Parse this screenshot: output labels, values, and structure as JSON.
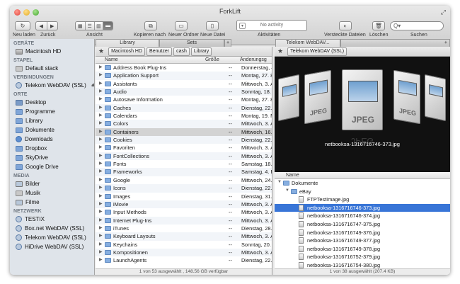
{
  "window": {
    "title": "ForkLift"
  },
  "toolbar": {
    "back_label": "Neu laden",
    "forward_label": "Zurück",
    "view_label": "Ansicht",
    "copy_label": "Kopieren nach",
    "new_folder_label": "Neuer Ordner",
    "new_file_label": "Neue Datei",
    "activity_label": "Aktivitäten",
    "activity_text": "No activity",
    "hidden_files_label": "Versteckte Dateien",
    "delete_label": "Löschen",
    "search_label": "Suchen",
    "search_placeholder": "Q▾"
  },
  "sidebar": {
    "sections": [
      {
        "title": "GERÄTE",
        "items": [
          {
            "label": "Macintosh HD",
            "icon": "hard-drive-icon"
          }
        ]
      },
      {
        "title": "Stapel",
        "items": [
          {
            "label": "Default stack",
            "icon": "stack-icon"
          }
        ]
      },
      {
        "title": "VERBINDUNGEN",
        "items": [
          {
            "label": "Telekom WebDAV (SSL)",
            "icon": "network-icon",
            "eject": "⏏"
          }
        ]
      },
      {
        "title": "ORTE",
        "items": [
          {
            "label": "Desktop",
            "icon": "desktop-icon"
          },
          {
            "label": "Programme",
            "icon": "applications-icon"
          },
          {
            "label": "Library",
            "icon": "folder-icon"
          },
          {
            "label": "Dokumente",
            "icon": "documents-icon"
          },
          {
            "label": "Downloads",
            "icon": "downloads-icon"
          },
          {
            "label": "Dropbox",
            "icon": "folder-icon"
          },
          {
            "label": "SkyDrive",
            "icon": "folder-icon"
          },
          {
            "label": "Google Drive",
            "icon": "folder-icon"
          }
        ]
      },
      {
        "title": "MEDIA",
        "items": [
          {
            "label": "Bilder",
            "icon": "pictures-icon"
          },
          {
            "label": "Musik",
            "icon": "music-icon"
          },
          {
            "label": "Filme",
            "icon": "movies-icon"
          }
        ]
      },
      {
        "title": "NETZWERK",
        "items": [
          {
            "label": "TESTIX",
            "icon": "network-icon"
          },
          {
            "label": "Box.net WebDAV (SSL)",
            "icon": "network-icon"
          },
          {
            "label": "Telekom WebDAV (SSL)",
            "icon": "network-icon"
          },
          {
            "label": "HiDrive WebDAV (SSL)",
            "icon": "network-icon"
          }
        ]
      }
    ]
  },
  "left_tabs": [
    "Library",
    "Sets",
    "+"
  ],
  "right_tabs": [
    "Telekom WebDAV...",
    "+"
  ],
  "left_pane": {
    "breadcrumbs": [
      "Macintosh HD",
      "Benutzer",
      "cash",
      "Library"
    ],
    "columns": [
      "Name",
      "Größe",
      "Änderungsg"
    ],
    "rows": [
      {
        "name": "Address Book Plug-Ins",
        "size": "--",
        "date": "Donnerstag, 4"
      },
      {
        "name": "Application Support",
        "size": "--",
        "date": "Montag, 27. 8"
      },
      {
        "name": "Assistants",
        "size": "--",
        "date": "Mittwoch, 3. A"
      },
      {
        "name": "Audio",
        "size": "--",
        "date": "Sonntag, 18. I"
      },
      {
        "name": "Autosave Information",
        "size": "--",
        "date": "Montag, 27. 8"
      },
      {
        "name": "Caches",
        "size": "--",
        "date": "Dienstag, 22."
      },
      {
        "name": "Calendars",
        "size": "--",
        "date": "Montag, 19. M"
      },
      {
        "name": "Colors",
        "size": "--",
        "date": "Mittwoch, 3. A"
      },
      {
        "name": "Containers",
        "size": "--",
        "date": "Mittwoch, 16."
      },
      {
        "name": "Cookies",
        "size": "--",
        "date": "Dienstag, 22."
      },
      {
        "name": "Favoriten",
        "size": "--",
        "date": "Mittwoch, 3. A"
      },
      {
        "name": "FontCollections",
        "size": "--",
        "date": "Mittwoch, 3. A"
      },
      {
        "name": "Fonts",
        "size": "--",
        "date": "Samstag, 18."
      },
      {
        "name": "Frameworks",
        "size": "--",
        "date": "Samstag, 4. F"
      },
      {
        "name": "Google",
        "size": "--",
        "date": "Mittwoch, 24."
      },
      {
        "name": "Icons",
        "size": "--",
        "date": "Dienstag, 22."
      },
      {
        "name": "Images",
        "size": "--",
        "date": "Dienstag, 31."
      },
      {
        "name": "iMovie",
        "size": "--",
        "date": "Mittwoch, 3. A"
      },
      {
        "name": "Input Methods",
        "size": "--",
        "date": "Mittwoch, 3. A"
      },
      {
        "name": "Internet Plug-Ins",
        "size": "--",
        "date": "Mittwoch, 3. A"
      },
      {
        "name": "iTunes",
        "size": "--",
        "date": "Dienstag, 28."
      },
      {
        "name": "Keyboard Layouts",
        "size": "--",
        "date": "Mittwoch, 3. A"
      },
      {
        "name": "Keychains",
        "size": "--",
        "date": "Sonntag, 20. I"
      },
      {
        "name": "Kompositionen",
        "size": "--",
        "date": "Mittwoch, 3. A"
      },
      {
        "name": "LaunchAgents",
        "size": "--",
        "date": "Dienstag, 22."
      }
    ],
    "status": "1 von 53 ausgewählt , 148.56 GB verfügbar"
  },
  "right_pane": {
    "connection": "Telekom WebDAV (SSL)",
    "preview_label": "JPEG",
    "preview_label_reflection": "JPEG",
    "preview_caption": "netbooksa-1316716746-373.jpg",
    "column": "Name",
    "tree": [
      {
        "name": "Dokumente",
        "level": 0,
        "folder": true
      },
      {
        "name": "eBay",
        "level": 1,
        "folder": true
      },
      {
        "name": "FTPTestImage.jpg",
        "level": 2,
        "folder": false
      },
      {
        "name": "netbooksa-1316716746-373.jpg",
        "level": 2,
        "folder": false,
        "selected": true
      },
      {
        "name": "netbooksa-1316716746-374.jpg",
        "level": 2,
        "folder": false
      },
      {
        "name": "netbooksa-1316716747-375.jpg",
        "level": 2,
        "folder": false
      },
      {
        "name": "netbooksa-1316716749-376.jpg",
        "level": 2,
        "folder": false
      },
      {
        "name": "netbooksa-1316716749-377.jpg",
        "level": 2,
        "folder": false
      },
      {
        "name": "netbooksa-1316716749-378.jpg",
        "level": 2,
        "folder": false
      },
      {
        "name": "netbooksa-1316716752-379.jpg",
        "level": 2,
        "folder": false
      },
      {
        "name": "netbooksa-1316716754-380.jpg",
        "level": 2,
        "folder": false
      },
      {
        "name": "netbooksa-1316716755-381.jpg",
        "level": 2,
        "folder": false
      }
    ],
    "status": "1 von 38 ausgewählt  (207.4 KB)"
  },
  "colors": {
    "selection": "#3875d7",
    "sidebar": "#dfe4ea"
  }
}
